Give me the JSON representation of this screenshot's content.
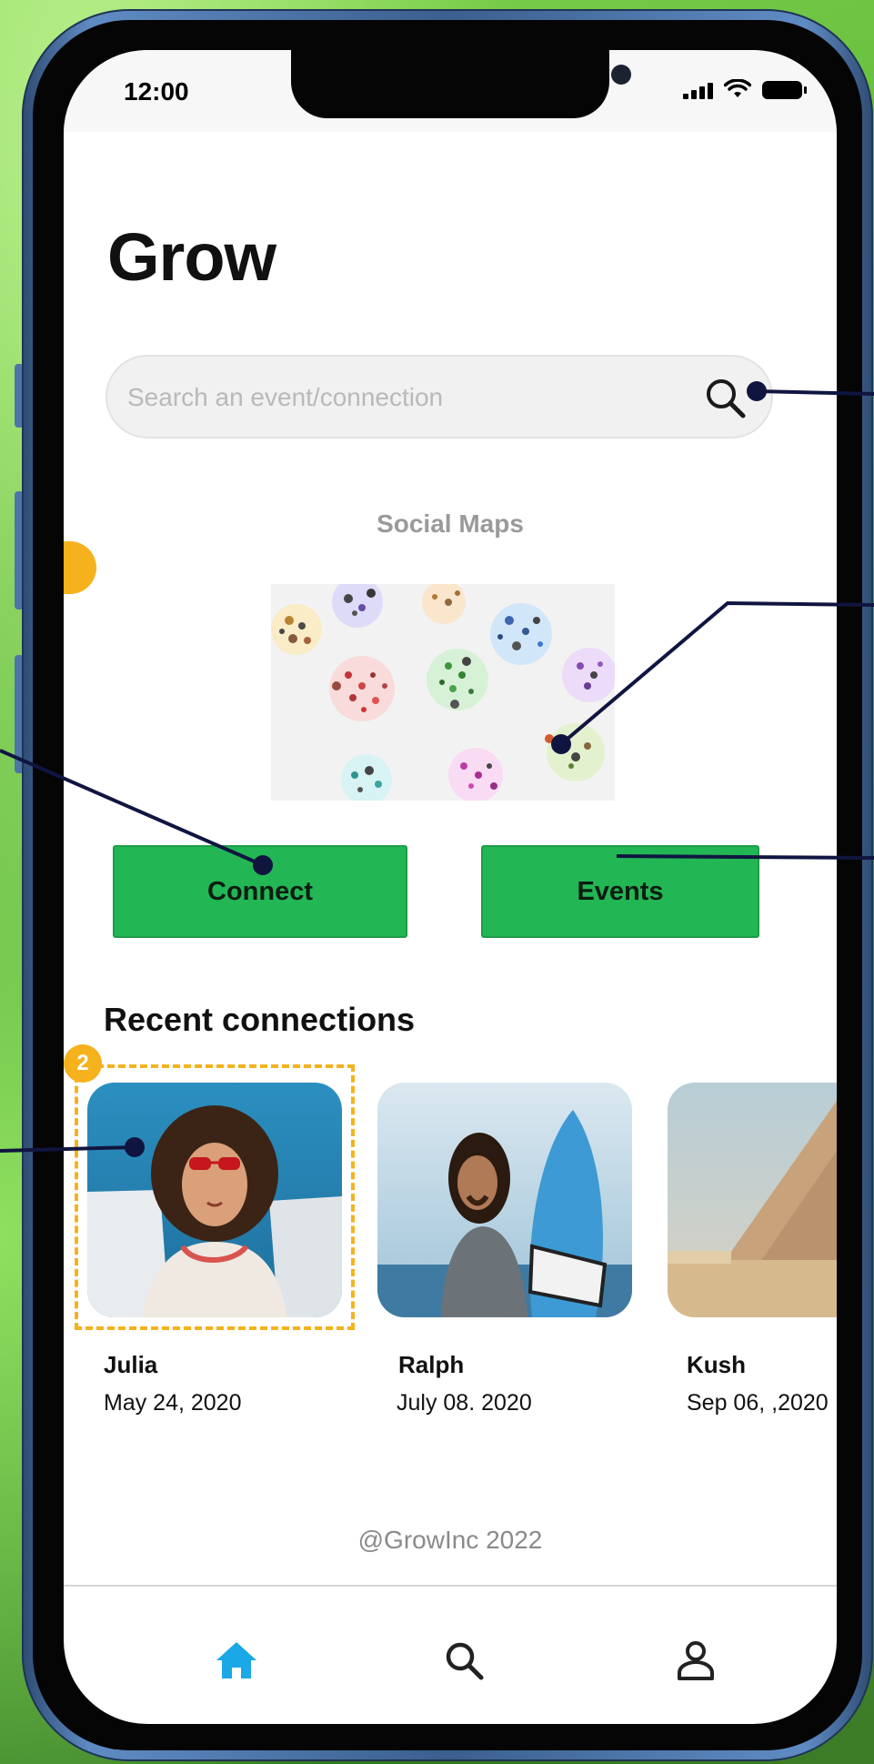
{
  "status_bar": {
    "time": "12:00"
  },
  "app": {
    "title": "Grow"
  },
  "search": {
    "placeholder": "Search an event/connection",
    "icon": "search-icon"
  },
  "social_maps": {
    "title": "Social Maps"
  },
  "actions": {
    "connect_label": "Connect",
    "events_label": "Events"
  },
  "recent": {
    "title": "Recent connections",
    "badge": "2",
    "items": [
      {
        "name": "Julia",
        "date": "May 24, 2020"
      },
      {
        "name": "Ralph",
        "date": "July 08. 2020"
      },
      {
        "name": "Kush",
        "date": "Sep 06, ,2020"
      }
    ]
  },
  "footer": {
    "text": "@GrowInc 2022"
  },
  "bottom_nav": {
    "items": [
      {
        "icon": "home-icon",
        "active": true
      },
      {
        "icon": "search-icon",
        "active": false
      },
      {
        "icon": "profile-icon",
        "active": false
      }
    ]
  },
  "colors": {
    "accent_green": "#23b654",
    "highlight": "#f5b21c",
    "nav_active": "#1ba8e6",
    "annotation_line": "#101540"
  }
}
